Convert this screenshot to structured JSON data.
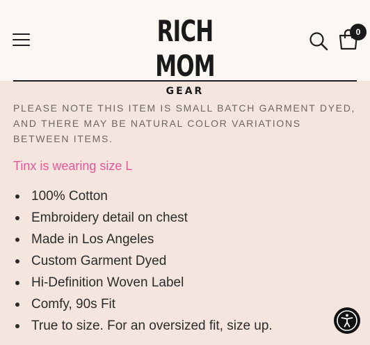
{
  "header": {
    "logo_main": "RICH MOM",
    "logo_sub": "GEAR",
    "menu_icon": "hamburger-menu-icon",
    "search_icon": "search-icon",
    "cart_icon": "shopping-bag-icon",
    "cart_count": "0"
  },
  "product": {
    "note": "PLEASE NOTE THIS ITEM IS SMALL BATCH GARMENT DYED, AND THERE MAY BE NATURAL COLOR VARIATIONS BETWEEN ITEMS.",
    "wearing": "Tinx is wearing size L",
    "features": [
      "100% Cotton",
      "Embroidery detail on chest",
      "Made in Los Angeles",
      "Custom Garment Dyed",
      "Hi-Definition Woven Label",
      "Comfy, 90s Fit",
      "True to size. For an oversized fit, size up."
    ]
  },
  "accessibility": {
    "icon": "accessibility-icon"
  },
  "colors": {
    "background": "#f4e6de",
    "header_background": "#fbf7f3",
    "accent_pink": "#e8559a",
    "note_text": "#6c6662",
    "text": "#2b2b2b"
  }
}
